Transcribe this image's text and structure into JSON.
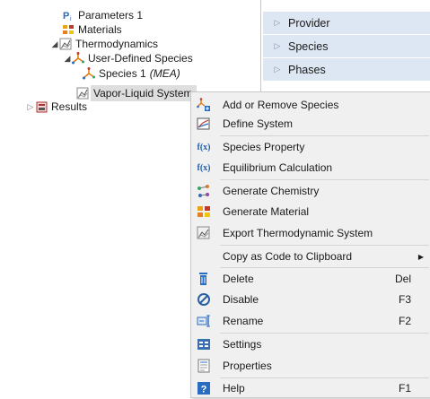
{
  "tree": {
    "parameters": "Parameters 1",
    "materials": "Materials",
    "thermodynamics": "Thermodynamics",
    "user_defined_species": "User-Defined Species",
    "species_1": "Species 1",
    "species_1_tag": "(MEA)",
    "vapor_liquid": "Vapor-Liquid System",
    "results": "Results"
  },
  "sections": [
    "Provider",
    "Species",
    "Phases"
  ],
  "menu": {
    "add_remove_species": "Add or Remove Species",
    "define_system": "Define System",
    "species_property": "Species Property",
    "equilibrium_calculation": "Equilibrium Calculation",
    "generate_chemistry": "Generate Chemistry",
    "generate_material": "Generate Material",
    "export_thermo": "Export Thermodynamic System",
    "copy_as_code": "Copy as Code to Clipboard",
    "delete": "Delete",
    "delete_shortcut": "Del",
    "disable": "Disable",
    "disable_shortcut": "F3",
    "rename": "Rename",
    "rename_shortcut": "F2",
    "settings": "Settings",
    "properties": "Properties",
    "help": "Help",
    "help_shortcut": "F1"
  },
  "colors": {
    "section_bg": "#dde7f3",
    "selection_bg": "#dedede",
    "menu_bg": "#f0f0f0",
    "accent_blue": "#1f5fae"
  }
}
